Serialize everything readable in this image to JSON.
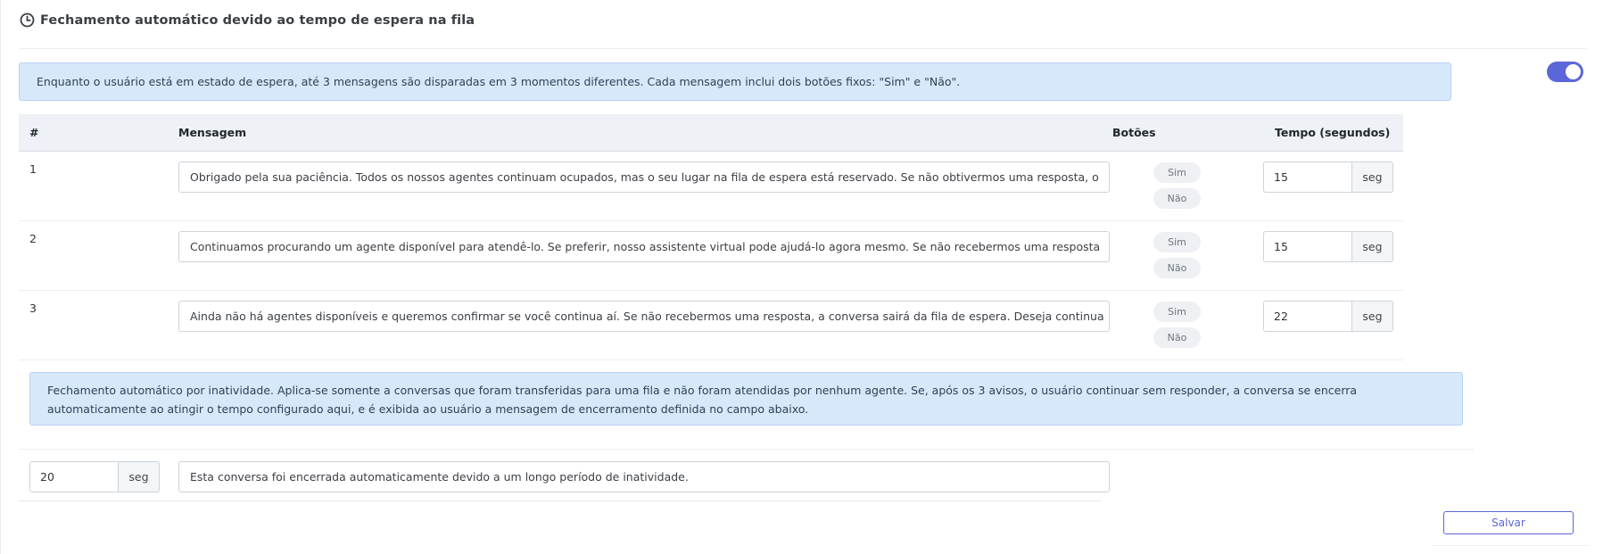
{
  "header": {
    "title": "Fechamento automático devido ao tempo de espera na fila",
    "icon": "clock-icon",
    "toggle_enabled": true
  },
  "colors": {
    "accent": "#5b67d8",
    "info_bg": "#d8e8fb",
    "table_header_bg": "#eef1f6"
  },
  "info_wait": "Enquanto o usuário está em estado de espera, até 3 mensagens são disparadas em 3 momentos diferentes. Cada mensagem inclui dois botões fixos: \"Sim\" e \"Não\".",
  "table": {
    "columns": [
      "#",
      "Mensagem",
      "Botões",
      "Tempo (segundos)"
    ],
    "rows": [
      {
        "num": "1",
        "message": "Obrigado pela sua paciência. Todos os nossos agentes continuam ocupados, mas o seu lugar na fila de espera está reservado. Se não obtivermos uma resposta, o",
        "btn_yes": "Sim",
        "btn_no": "Não",
        "time": "15",
        "unit": "seg"
      },
      {
        "num": "2",
        "message": "Continuamos procurando um agente disponível para atendê-lo. Se preferir, nosso assistente virtual pode ajudá-lo agora mesmo. Se não recebermos uma resposta",
        "btn_yes": "Sim",
        "btn_no": "Não",
        "time": "15",
        "unit": "seg"
      },
      {
        "num": "3",
        "message": "Ainda não há agentes disponíveis e queremos confirmar se você continua aí. Se não recebermos uma resposta, a conversa sairá da fila de espera. Deseja continua",
        "btn_yes": "Sim",
        "btn_no": "Não",
        "time": "22",
        "unit": "seg"
      }
    ]
  },
  "info_inactivity": "Fechamento automático por inatividade. Aplica-se somente a conversas que foram transferidas para uma fila e não foram atendidas por nenhum agente. Se, após os 3 avisos, o usuário continuar sem responder, a conversa se encerra automaticamente ao atingir o tempo configurado aqui, e é exibida ao usuário a mensagem de encerramento definida no campo abaixo.",
  "closing": {
    "time": "20",
    "unit": "seg",
    "message": "Esta conversa foi encerrada automaticamente devido a um longo período de inatividade."
  },
  "save_label": "Salvar"
}
